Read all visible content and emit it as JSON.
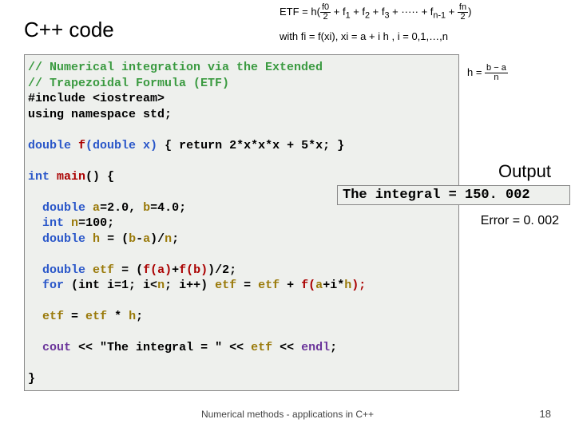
{
  "title": "C++ code",
  "handwriting": {
    "etf_formula": "ETF = h( f0/2 + f1 + f2 + f3 + ····· + fn-1 + fn/2 )",
    "fi_def": "with  fi = f(xi),   xi = a + i h ,   i = 0,1,…,n",
    "h_def": "h = (b − a) / n"
  },
  "code": {
    "c1": "// Numerical integration via the Extended",
    "c2": "// Trapezoidal Formula (ETF)",
    "inc1": "#include <iostream>",
    "inc2": "using namespace std;",
    "fsig_t1": "double",
    "fsig_fn": "f",
    "fsig_p": "(double x)",
    "fsig_body": " { return 2*x*x*x + 5*x; }",
    "main_t": "int",
    "main_fn": "main",
    "main_p": "()",
    "lb": " {",
    "decl_a_t": "double",
    "decl_a_id": "a",
    "decl_a_eq": "=2.0,",
    "decl_b_id": "b",
    "decl_b_eq": "=4.0;",
    "decl_n_t": "int",
    "decl_n_id": "n",
    "decl_n_eq": "=100;",
    "decl_h_t": "double",
    "decl_h_id": "h",
    "decl_h_eq": " = (",
    "decl_h_b": "b",
    "decl_h_m": "-",
    "decl_h_a": "a",
    "decl_h_e": ")/",
    "decl_h_n": "n",
    "semi": ";",
    "etf1_t": "double",
    "etf1_id": "etf",
    "etf1_eq": " = (",
    "etf1_fa": "f(a)",
    "etf1_plus": "+",
    "etf1_fb": "f(b)",
    "etf1_end": ")/2;",
    "for_kw": "for",
    "for_p": " (int i=1; i<",
    "for_n": "n",
    "for_p2": "; i++) ",
    "for_etf": "etf",
    "for_eq": " = ",
    "for_etf2": "etf",
    "for_plus": " + ",
    "for_f": "f(",
    "for_a": "a",
    "for_pl2": "+i*",
    "for_h": "h",
    "for_cl": ");",
    "etf3_id": "etf",
    "etf3_eq": " = ",
    "etf3_id2": "etf",
    "etf3_mul": " * ",
    "etf3_h": "h",
    "cout_kw": "cout",
    "cout_op": " << ",
    "cout_str": "\"The integral = \"",
    "cout_etf": "etf",
    "cout_endl": "endl",
    "rb": "}"
  },
  "output": {
    "title": "Output",
    "text": "The integral = 150. 002",
    "error": "Error = 0. 002"
  },
  "footer": "Numerical methods - applications in C++",
  "page": "18"
}
